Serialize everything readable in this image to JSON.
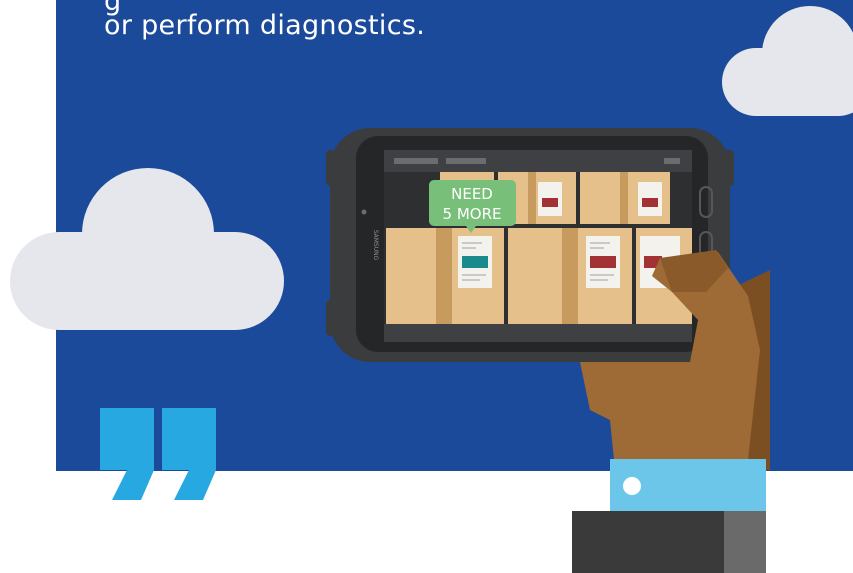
{
  "caption": {
    "line1": "g",
    "line2": "or perform diagnostics."
  },
  "tablet": {
    "brand": "SAMSUNG",
    "callout_line1": "NEED",
    "callout_line2": "5 MORE"
  },
  "colors": {
    "background": "#1c4a9b",
    "cloud": "#e6e7ec",
    "callout": "#78c07a",
    "box": "#e5c08a",
    "quote": "#27a8e0",
    "sleeve": "#6cc6ea",
    "skin": "#9e6a35"
  },
  "icons": [
    "cloud-icon",
    "quote-mark-icon",
    "tablet-device",
    "hand-illustration"
  ]
}
